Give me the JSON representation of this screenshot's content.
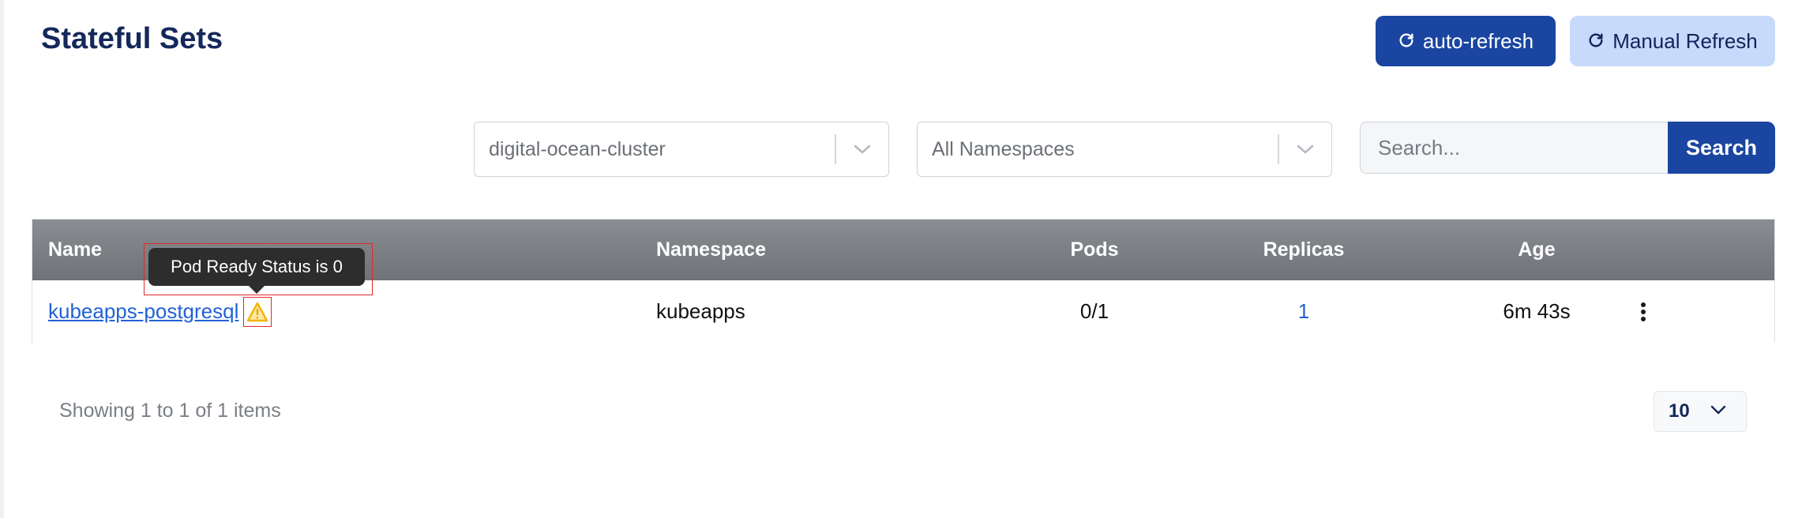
{
  "page": {
    "title": "Stateful Sets"
  },
  "toolbar": {
    "auto_refresh_label": "auto-refresh",
    "manual_refresh_label": "Manual Refresh",
    "refresh_icon": "refresh-icon"
  },
  "filters": {
    "cluster": {
      "value": "digital-ocean-cluster"
    },
    "namespace": {
      "value": "All Namespaces"
    },
    "search": {
      "placeholder": "Search...",
      "button_label": "Search"
    }
  },
  "table": {
    "columns": [
      "Name",
      "Namespace",
      "Pods",
      "Replicas",
      "Age"
    ],
    "rows": [
      {
        "name": "kubeapps-postgresql",
        "namespace": "kubeapps",
        "pods": "0/1",
        "replicas": "1",
        "age": "6m 43s",
        "status_icon": "warning-icon"
      }
    ]
  },
  "tooltip": {
    "text": "Pod Ready Status is 0"
  },
  "pagination": {
    "summary": "Showing 1 to 1 of 1 items",
    "page_size": "10"
  },
  "colors": {
    "primary": "#1a45a0",
    "secondary": "#c7dafb",
    "link": "#2162d6",
    "warning": "#f4b400"
  }
}
